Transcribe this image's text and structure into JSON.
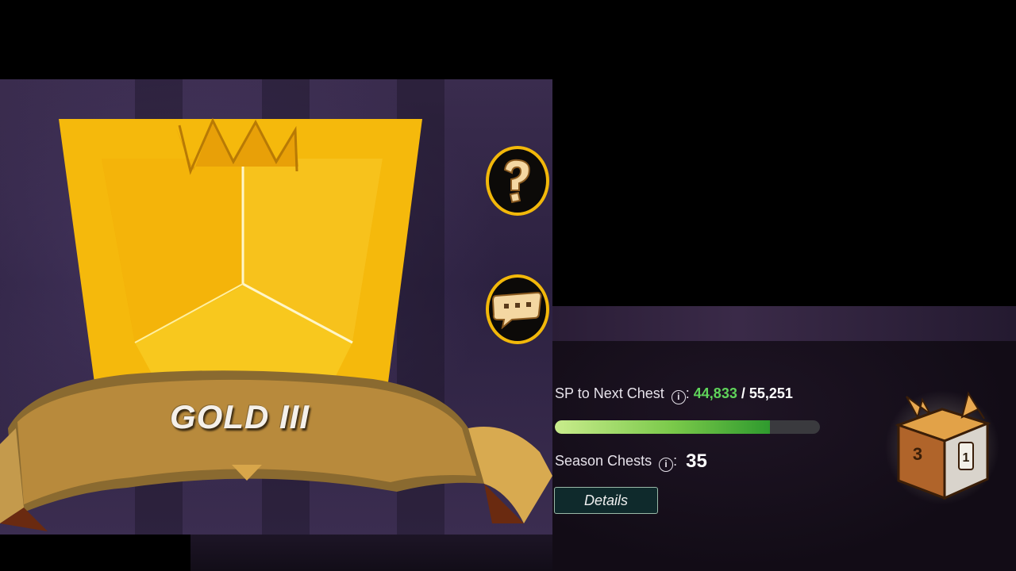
{
  "league": {
    "name": "GOLD III"
  },
  "sp": {
    "label": "SP to Next Chest",
    "colon": ":",
    "current": "44,833",
    "separator": "/",
    "total": "55,251",
    "progress": 0.81
  },
  "season": {
    "label": "Season Chests",
    "colon": ":",
    "count": "35"
  },
  "buttons": {
    "details": "Details",
    "help_icon": "question-mark-icon",
    "chat_icon": "speech-bubble-icon"
  },
  "colors": {
    "gold": "#f2b80a",
    "sp_current": "#5fd35a",
    "progress_fill": "#2f9a2e"
  }
}
